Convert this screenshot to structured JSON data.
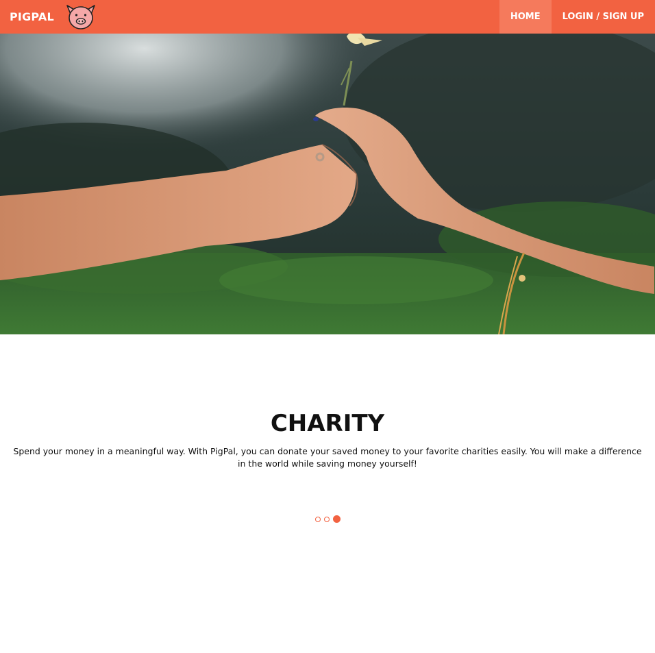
{
  "brand": {
    "name": "PIGPAL",
    "logo_icon": "pig-face-icon"
  },
  "nav": {
    "items": [
      {
        "label": "HOME",
        "active": true
      },
      {
        "label": "LOGIN / SIGN UP",
        "active": false
      }
    ]
  },
  "hero": {
    "image": "hands-passing-flower-photo"
  },
  "slide": {
    "title": "CHARITY",
    "description": "Spend your money in a meaningful way. With PigPal, you can donate your saved money to your favorite charities easily. You will make a difference in the world while saving money yourself!"
  },
  "carousel": {
    "total": 3,
    "active_index": 2
  },
  "colors": {
    "accent": "#f26241",
    "accent_light": "#f57a5c",
    "text": "#111111"
  }
}
